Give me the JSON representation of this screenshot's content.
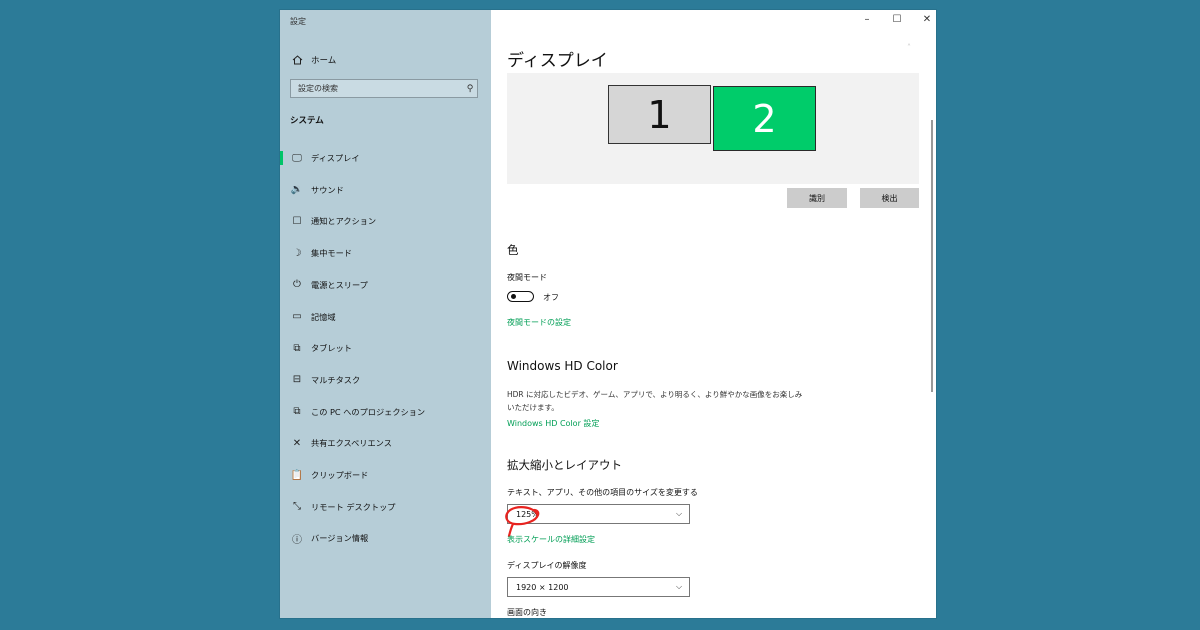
{
  "window": {
    "title": "設定",
    "controls": [
      "–",
      "☐",
      "✕"
    ]
  },
  "sidebar": {
    "home_label": "ホーム",
    "search_placeholder": "設定の検索",
    "section_title": "システム",
    "items": [
      {
        "label": "ディスプレイ",
        "icon": "monitor-icon",
        "glyph": "🖵",
        "selected": true
      },
      {
        "label": "サウンド",
        "icon": "speaker-icon",
        "glyph": "🔉",
        "selected": false
      },
      {
        "label": "通知とアクション",
        "icon": "notification-icon",
        "glyph": "☐",
        "selected": false
      },
      {
        "label": "集中モード",
        "icon": "moon-icon",
        "glyph": "☽",
        "selected": false
      },
      {
        "label": "電源とスリープ",
        "icon": "power-icon",
        "glyph": "⏻",
        "selected": false
      },
      {
        "label": "記憶域",
        "icon": "storage-icon",
        "glyph": "▭",
        "selected": false
      },
      {
        "label": "タブレット",
        "icon": "tablet-icon",
        "glyph": "⧉",
        "selected": false
      },
      {
        "label": "マルチタスク",
        "icon": "multitask-icon",
        "glyph": "⊟",
        "selected": false
      },
      {
        "label": "この PC へのプロジェクション",
        "icon": "projection-icon",
        "glyph": "⧉",
        "selected": false
      },
      {
        "label": "共有エクスペリエンス",
        "icon": "shared-experience-icon",
        "glyph": "✕",
        "selected": false
      },
      {
        "label": "クリップボード",
        "icon": "clipboard-icon",
        "glyph": "📋",
        "selected": false
      },
      {
        "label": "リモート デスクトップ",
        "icon": "remote-desktop-icon",
        "glyph": "⤡",
        "selected": false
      },
      {
        "label": "バージョン情報",
        "icon": "info-icon",
        "glyph": "ⓘ",
        "selected": false
      }
    ]
  },
  "main": {
    "title": "ディスプレイ",
    "monitors": [
      "1",
      "2"
    ],
    "identify_button": "識別",
    "detect_button": "検出",
    "color": {
      "title": "色",
      "night_mode_label": "夜間モード",
      "night_mode_state": "オフ",
      "night_mode_on": false,
      "night_mode_link": "夜間モードの設定"
    },
    "hdr": {
      "title": "Windows HD Color",
      "description": "HDR に対応したビデオ、ゲーム、アプリで、より明るく、より鮮やかな画像をお楽しみいただけます。",
      "link": "Windows HD Color 設定"
    },
    "scale": {
      "title": "拡大縮小とレイアウト",
      "scale_label": "テキスト、アプリ、その他の項目のサイズを変更する",
      "scale_value": "125%",
      "advanced_link": "表示スケールの詳細設定",
      "resolution_label": "ディスプレイの解像度",
      "resolution_value": "1920 × 1200",
      "orientation_label": "画面の向き"
    }
  },
  "colors": {
    "accent": "#00c468",
    "link": "#009e55",
    "sidebar_bg": "#b6cdd7",
    "desktop_bg": "#2c7b98",
    "annotation": "#e8231f"
  }
}
